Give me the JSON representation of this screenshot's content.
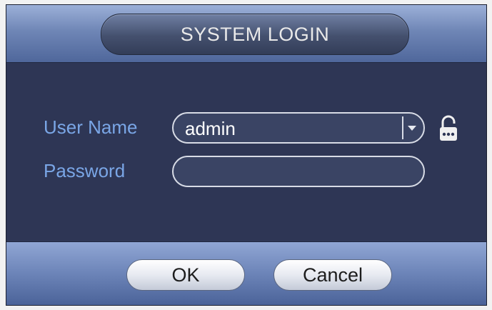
{
  "dialog": {
    "title": "SYSTEM LOGIN"
  },
  "form": {
    "username_label": "User Name",
    "username_value": "admin",
    "password_label": "Password",
    "password_value": ""
  },
  "icons": {
    "dropdown": "chevron-down-icon",
    "lock": "lock-icon"
  },
  "buttons": {
    "ok_label": "OK",
    "cancel_label": "Cancel"
  }
}
